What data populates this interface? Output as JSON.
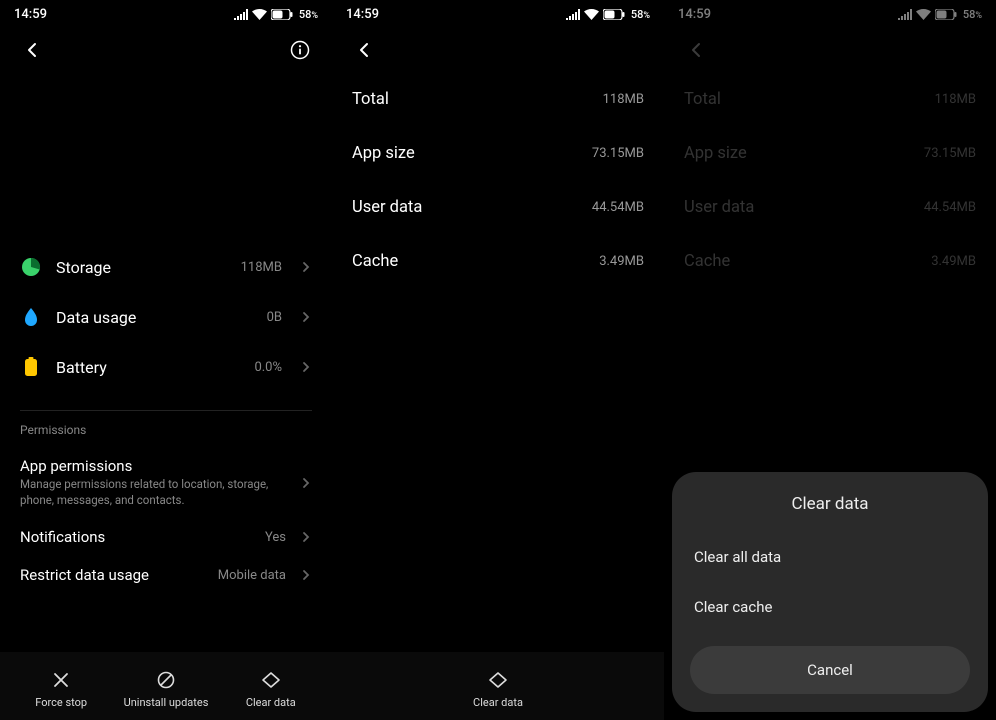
{
  "status": {
    "time": "14:59",
    "battery": "58",
    "battery_suffix": "%"
  },
  "screen1": {
    "storage": {
      "label": "Storage",
      "value": "118MB"
    },
    "data_usage": {
      "label": "Data usage",
      "value": "0B"
    },
    "battery": {
      "label": "Battery",
      "value": "0.0%"
    },
    "permissions_header": "Permissions",
    "app_permissions": {
      "title": "App permissions",
      "sub": "Manage permissions related to location, storage, phone, messages, and contacts."
    },
    "notifications": {
      "title": "Notifications",
      "value": "Yes"
    },
    "restrict": {
      "title": "Restrict data usage",
      "value": "Mobile data"
    },
    "bottom": {
      "force_stop": "Force stop",
      "uninstall": "Uninstall updates",
      "clear_data": "Clear data"
    }
  },
  "storage_detail": {
    "total": {
      "label": "Total",
      "value": "118MB"
    },
    "app_size": {
      "label": "App size",
      "value": "73.15MB"
    },
    "user_data": {
      "label": "User data",
      "value": "44.54MB"
    },
    "cache": {
      "label": "Cache",
      "value": "3.49MB"
    },
    "clear_data": "Clear data"
  },
  "sheet": {
    "title": "Clear data",
    "clear_all": "Clear all data",
    "clear_cache": "Clear cache",
    "cancel": "Cancel"
  }
}
